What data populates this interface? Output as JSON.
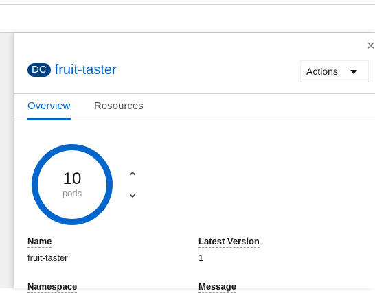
{
  "panel": {
    "close_glyph": "×",
    "kind_badge": "DC",
    "resource_name": "fruit-taster",
    "actions_label": "Actions"
  },
  "tabs": [
    {
      "label": "Overview",
      "active": true
    },
    {
      "label": "Resources",
      "active": false
    }
  ],
  "pods": {
    "count": "10",
    "unit": "pods",
    "ring_color": "#0066cc"
  },
  "details": {
    "name_label": "Name",
    "name_value": "fruit-taster",
    "latest_version_label": "Latest Version",
    "latest_version_value": "1",
    "namespace_label": "Namespace",
    "message_label": "Message"
  },
  "colors": {
    "link": "#0066cc",
    "badge": "#004080"
  }
}
